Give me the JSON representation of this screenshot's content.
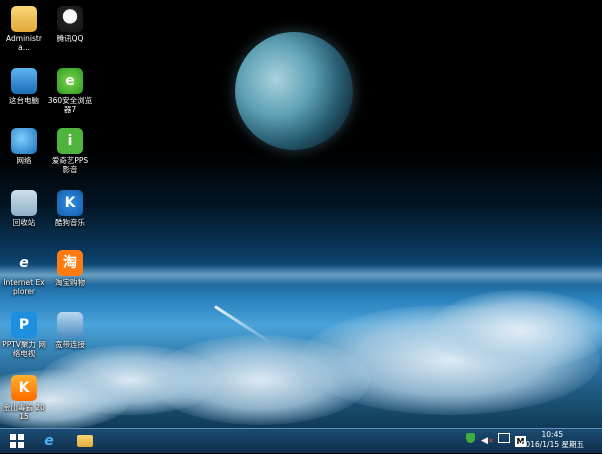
{
  "desktop": {
    "icons": [
      {
        "label": "Administra...",
        "icon": "folder-icon"
      },
      {
        "label": "腾讯QQ",
        "icon": "qq-icon"
      },
      {
        "label": "这台电脑",
        "icon": "computer-icon"
      },
      {
        "label": "360安全浏览器7",
        "icon": "360-browser-icon"
      },
      {
        "label": "网络",
        "icon": "network-icon"
      },
      {
        "label": "爱奇艺PPS 影音",
        "icon": "iqiyi-icon"
      },
      {
        "label": "回收站",
        "icon": "recycle-bin-icon"
      },
      {
        "label": "酷狗音乐",
        "icon": "kugou-icon"
      },
      {
        "label": "Internet Explorer",
        "icon": "ie-icon"
      },
      {
        "label": "淘宝购物",
        "icon": "taobao-icon"
      },
      {
        "label": "PPTV聚力 网络电视",
        "icon": "pptv-icon"
      },
      {
        "label": "宽带连接",
        "icon": "broadband-icon"
      },
      {
        "label": "金山毒霸 2015",
        "icon": "kingsoft-icon"
      }
    ]
  },
  "taskbar": {
    "clock": {
      "time": "10:45",
      "date": "2016/1/15 星期五"
    },
    "tray_m": "M"
  }
}
